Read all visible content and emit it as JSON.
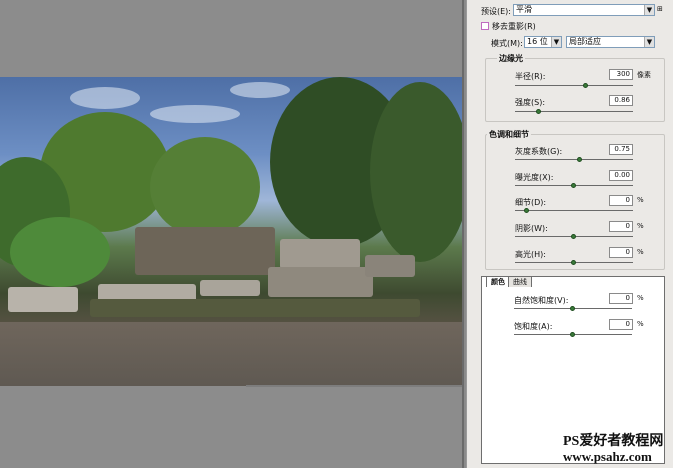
{
  "dialog": {
    "preset_label": "预设(E):",
    "preset_value": "平滑",
    "remove_ghosts_label": "移去重影(R)",
    "mode_label": "模式(M):",
    "mode_bits": "16 位",
    "mode_method": "局部适应",
    "edge_glow": {
      "title": "边缘光",
      "radius_label": "半径(R):",
      "radius_value": "300",
      "radius_unit": "像素",
      "radius_level": 0.6,
      "strength_label": "强度(S):",
      "strength_value": "0.86",
      "strength_level": 0.2
    },
    "tone_detail": {
      "title": "色调和细节",
      "gamma_label": "灰度系数(G):",
      "gamma_value": "0.75",
      "gamma_level": 0.55,
      "exposure_label": "曝光度(X):",
      "exposure_value": "0.00",
      "exposure_level": 0.5,
      "detail_label": "细节(D):",
      "detail_value": "0",
      "detail_unit": "%",
      "detail_level": 0.1,
      "shadow_label": "阴影(W):",
      "shadow_value": "0",
      "shadow_unit": "%",
      "shadow_level": 0.5,
      "highlight_label": "高光(H):",
      "highlight_value": "0",
      "highlight_unit": "%",
      "highlight_level": 0.5
    },
    "tabs": [
      "颜色",
      "曲线"
    ],
    "color": {
      "vibrance_label": "自然饱和度(V):",
      "vibrance_value": "0",
      "vibrance_unit": "%",
      "vibrance_level": 0.5,
      "saturation_label": "饱和度(A):",
      "saturation_value": "0",
      "saturation_unit": "%",
      "saturation_level": 0.5
    }
  },
  "watermark": {
    "line1": "PS爱好者教程网",
    "line2": "www.psahz.com"
  }
}
